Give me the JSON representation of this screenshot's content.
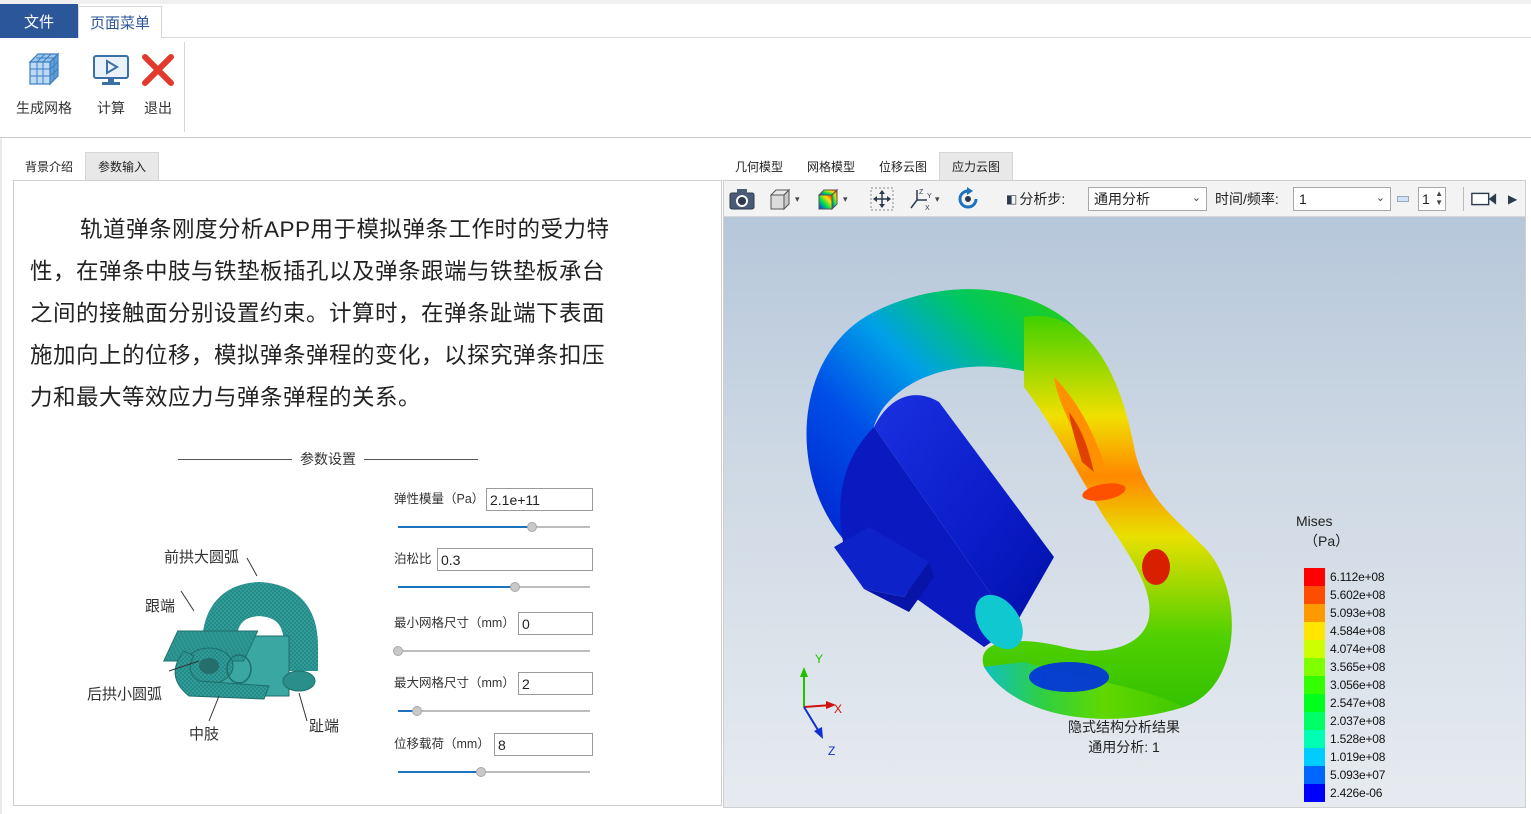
{
  "menu": {
    "file_tab": "文件",
    "page_menu_tab": "页面菜单"
  },
  "ribbon": {
    "buttons": [
      {
        "label": "生成网格",
        "icon": "mesh-cube-icon"
      },
      {
        "label": "计算",
        "icon": "monitor-play-icon"
      },
      {
        "label": "退出",
        "icon": "red-x-icon"
      }
    ]
  },
  "left_tabs": [
    {
      "label": "背景介绍",
      "active": false
    },
    {
      "label": "参数输入",
      "active": true
    }
  ],
  "right_tabs": [
    {
      "label": "几何模型",
      "active": false
    },
    {
      "label": "网格模型",
      "active": false
    },
    {
      "label": "位移云图",
      "active": false
    },
    {
      "label": "应力云图",
      "active": true
    }
  ],
  "intro_text": "轨道弹条刚度分析APP用于模拟弹条工作时的受力特性，在弹条中肢与铁垫板插孔以及弹条跟端与铁垫板承台之间的接触面分别设置约束。计算时，在弹条趾端下表面施加向上的位移，模拟弹条弹程的变化，以探究弹条扣压力和最大等效应力与弹条弹程的关系。",
  "params": {
    "heading": "参数设置",
    "fields": [
      {
        "label": "弹性模量（Pa）",
        "value": "2.1e+11",
        "slider": 0.7
      },
      {
        "label": "泊松比",
        "value": "0.3",
        "slider": 0.61
      },
      {
        "label": "最小网格尺寸（mm）",
        "value": "0",
        "slider": 0.0
      },
      {
        "label": "最大网格尺寸（mm）",
        "value": "2",
        "slider": 0.1
      },
      {
        "label": "位移载荷（mm）",
        "value": "8",
        "slider": 0.43
      }
    ]
  },
  "figure_labels": {
    "front_arc": "前拱大圆弧",
    "heel": "跟端",
    "rear_arc": "后拱小圆弧",
    "middle_limb": "中肢",
    "toe": "趾端"
  },
  "viewer_toolbar": {
    "step_label": "分析步:",
    "step_value": "通用分析",
    "time_label": "时间/频率:",
    "time_value": "1",
    "frame_value": "1"
  },
  "axes": {
    "x": "X",
    "y": "Y",
    "z": "Z"
  },
  "legend": {
    "title": "Mises",
    "unit": "（Pa）",
    "entries": [
      {
        "value": "6.112e+08",
        "color": "#ff0000"
      },
      {
        "value": "5.602e+08",
        "color": "#ff4d00"
      },
      {
        "value": "5.093e+08",
        "color": "#ff9900"
      },
      {
        "value": "4.584e+08",
        "color": "#ffe500"
      },
      {
        "value": "4.074e+08",
        "color": "#ccff00"
      },
      {
        "value": "3.565e+08",
        "color": "#80ff00"
      },
      {
        "value": "3.056e+08",
        "color": "#33ff00"
      },
      {
        "value": "2.547e+08",
        "color": "#00ff1a"
      },
      {
        "value": "2.037e+08",
        "color": "#00ff66"
      },
      {
        "value": "1.528e+08",
        "color": "#00ffb3"
      },
      {
        "value": "1.019e+08",
        "color": "#00ccff"
      },
      {
        "value": "5.093e+07",
        "color": "#0066ff"
      },
      {
        "value": "2.426e-06",
        "color": "#0000ff"
      }
    ]
  },
  "result_caption": {
    "line1": "隐式结构分析结果",
    "line2": "通用分析: 1"
  }
}
